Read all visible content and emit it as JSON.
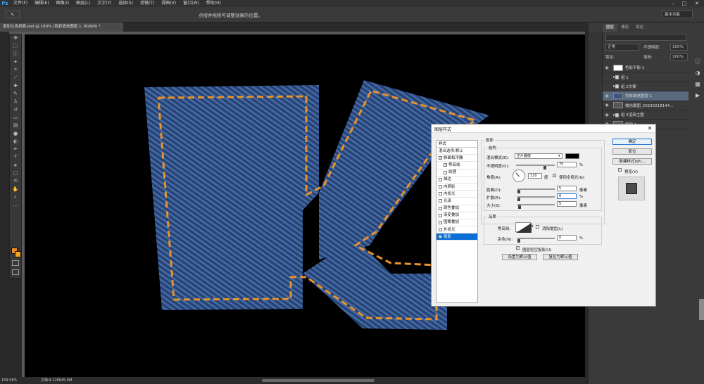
{
  "menubar": {
    "logo": "Ps",
    "items": [
      "文件(F)",
      "编辑(E)",
      "图像(I)",
      "图层(L)",
      "文字(Y)",
      "选择(S)",
      "滤镜(T)",
      "视图(V)",
      "窗口(W)",
      "帮助(H)"
    ],
    "controls": [
      "–",
      "□",
      "✕"
    ]
  },
  "optionsbar": {
    "hint": "点按并拖移可调整效果的位置。",
    "tool_glyph": "↖",
    "workspace": "基本功能"
  },
  "document_tab": {
    "label": "增加公告封面.psd @ 160% (色彩填充图层 1, RGB/8) *"
  },
  "status": {
    "zoom": "159.58%",
    "doc": "文档:4.12M/45.0M"
  },
  "layers_panel": {
    "tabs": [
      "图层",
      "通道",
      "路径"
    ],
    "blend_mode": "正常",
    "opacity_label": "不透明度:",
    "opacity_value": "100%",
    "lock_label": "锁定:",
    "fill_label": "填充:",
    "fill_value": "100%",
    "layers": [
      {
        "name": "色彩平衡 1",
        "type": "adjust",
        "visible": true,
        "selected": false
      },
      {
        "name": "组 1",
        "type": "group",
        "visible": false,
        "selected": false
      },
      {
        "name": "组 2文案",
        "type": "group",
        "visible": false,
        "selected": false
      },
      {
        "name": "色彩填充图层 1",
        "type": "layer",
        "visible": true,
        "selected": true
      },
      {
        "name": "微信截图_20230218144...",
        "type": "layer",
        "visible": true,
        "selected": false
      },
      {
        "name": "组 3渲染主图",
        "type": "group",
        "visible": true,
        "selected": false
      },
      {
        "name": "图层 1",
        "type": "layer",
        "visible": true,
        "selected": false
      }
    ]
  },
  "dialog": {
    "title": "图层样式",
    "close": "✕",
    "styles_header": "样式",
    "styles": [
      {
        "label": "混合选项:默认",
        "checkbox": false,
        "sub": false,
        "checked": false,
        "selected": false
      },
      {
        "label": "斜面和浮雕",
        "checkbox": true,
        "sub": false,
        "checked": true,
        "selected": false
      },
      {
        "label": "等高线",
        "checkbox": true,
        "sub": true,
        "checked": true,
        "selected": false
      },
      {
        "label": "纹理",
        "checkbox": true,
        "sub": true,
        "checked": false,
        "selected": false
      },
      {
        "label": "描边",
        "checkbox": true,
        "sub": false,
        "checked": false,
        "selected": false
      },
      {
        "label": "内阴影",
        "checkbox": true,
        "sub": false,
        "checked": false,
        "selected": false
      },
      {
        "label": "内发光",
        "checkbox": true,
        "sub": false,
        "checked": false,
        "selected": false
      },
      {
        "label": "光泽",
        "checkbox": true,
        "sub": false,
        "checked": false,
        "selected": false
      },
      {
        "label": "颜色叠加",
        "checkbox": true,
        "sub": false,
        "checked": false,
        "selected": false
      },
      {
        "label": "渐变叠加",
        "checkbox": true,
        "sub": false,
        "checked": false,
        "selected": false
      },
      {
        "label": "图案叠加",
        "checkbox": true,
        "sub": false,
        "checked": false,
        "selected": false
      },
      {
        "label": "外发光",
        "checkbox": true,
        "sub": false,
        "checked": false,
        "selected": false
      },
      {
        "label": "投影",
        "checkbox": true,
        "sub": false,
        "checked": true,
        "selected": true
      }
    ],
    "section_title": "投影",
    "structure_title": "结构",
    "blend_mode_label": "混合模式(B):",
    "blend_mode_value": "正片叠底",
    "opacity_label": "不透明度(O):",
    "opacity_value": "75",
    "opacity_fraction": 0.75,
    "angle_label": "角度(A):",
    "angle_value": "120",
    "degree_unit": "度",
    "global_light_label": "使用全局光(G)",
    "distance_label": "距离(D):",
    "distance_value": "5",
    "spread_label": "扩展(R):",
    "spread_value": "0",
    "size_label": "大小(S):",
    "size_value": "5",
    "px_unit": "像素",
    "pct_unit": "%",
    "quality_title": "品质",
    "contour_label": "等高线:",
    "antialias_label": "消除锯齿(L)",
    "noise_label": "杂色(N):",
    "noise_value": "0",
    "knockout_label": "图层挖空投影(U)",
    "make_default": "设置为默认值",
    "reset_default": "复位为默认值",
    "ok": "确定",
    "cancel": "复位",
    "new_style": "新建样式(W)...",
    "preview_label": "预览(V)",
    "shadow_color": "#000000"
  }
}
